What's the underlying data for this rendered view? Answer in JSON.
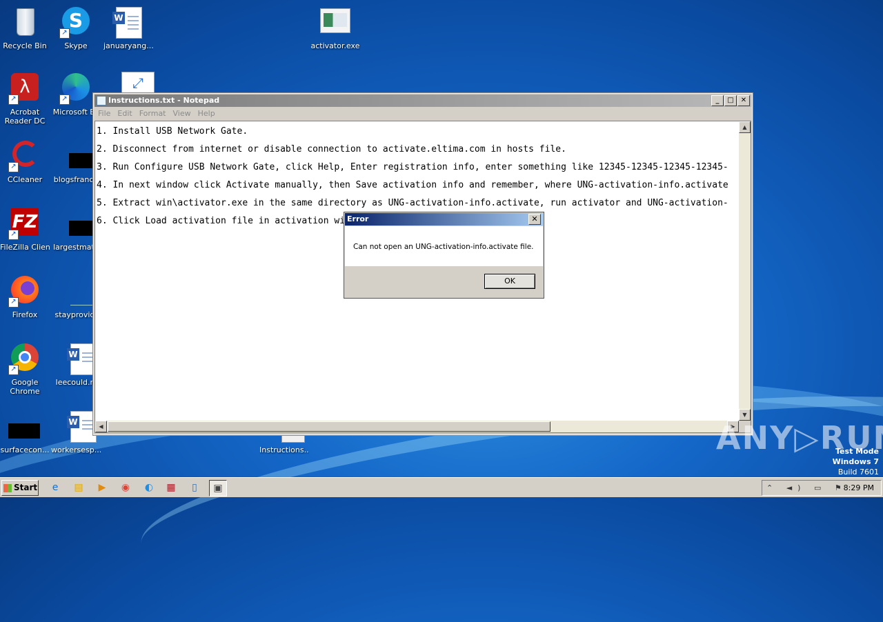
{
  "desktop": {
    "icons": [
      {
        "label": "Recycle Bin",
        "icon": "recycle-bin-icon"
      },
      {
        "label": "Skype",
        "icon": "skype-icon"
      },
      {
        "label": "januaryang...",
        "icon": "word-document-icon"
      },
      {
        "label": "activator.exe",
        "icon": "exe-file-icon"
      },
      {
        "label": "Acrobat Reader DC",
        "icon": "acrobat-icon"
      },
      {
        "label": "Microsoft Ec",
        "icon": "edge-icon"
      },
      {
        "label": "CCleaner",
        "icon": "ccleaner-icon"
      },
      {
        "label": "blogsfrance",
        "icon": "file-icon"
      },
      {
        "label": "FileZilla Client",
        "icon": "filezilla-icon"
      },
      {
        "label": "largestmatc",
        "icon": "file-icon"
      },
      {
        "label": "Firefox",
        "icon": "firefox-icon"
      },
      {
        "label": "stayprovidi",
        "icon": "file-icon"
      },
      {
        "label": "Google Chrome",
        "icon": "chrome-icon"
      },
      {
        "label": "leecould.rt",
        "icon": "word-document-icon"
      },
      {
        "label": "surfacecon...",
        "icon": "file-icon"
      },
      {
        "label": "workersesp...",
        "icon": "word-document-icon"
      },
      {
        "label": "Instructions...",
        "icon": "text-file-icon"
      }
    ]
  },
  "notepad": {
    "title": "Instructions.txt - Notepad",
    "menu": [
      "File",
      "Edit",
      "Format",
      "View",
      "Help"
    ],
    "lines": [
      "1. Install USB Network Gate.",
      "2. Disconnect from internet or disable connection to activate.eltima.com in hosts file.",
      "3. Run Configure USB Network Gate, click Help, Enter registration info, enter something like 12345-12345-12345-12345-",
      "4. In next window click Activate manually, then Save activation info and remember, where UNG-activation-info.activate",
      "5. Extract win\\activator.exe in the same directory as UNG-activation-info.activate, run activator and UNG-activation-",
      "6. Click Load activation file in activation window and select UNG-activation.bin"
    ]
  },
  "dialog": {
    "title": "Error",
    "message": "Can not open an UNG-activation-info.activate file.",
    "ok_label": "OK"
  },
  "watermark": {
    "brand": "ANY▷RUN",
    "test_mode": "Test Mode",
    "os": "Windows 7",
    "build": "Build 7601"
  },
  "taskbar": {
    "start_label": "Start",
    "clock": "8:29 PM"
  }
}
